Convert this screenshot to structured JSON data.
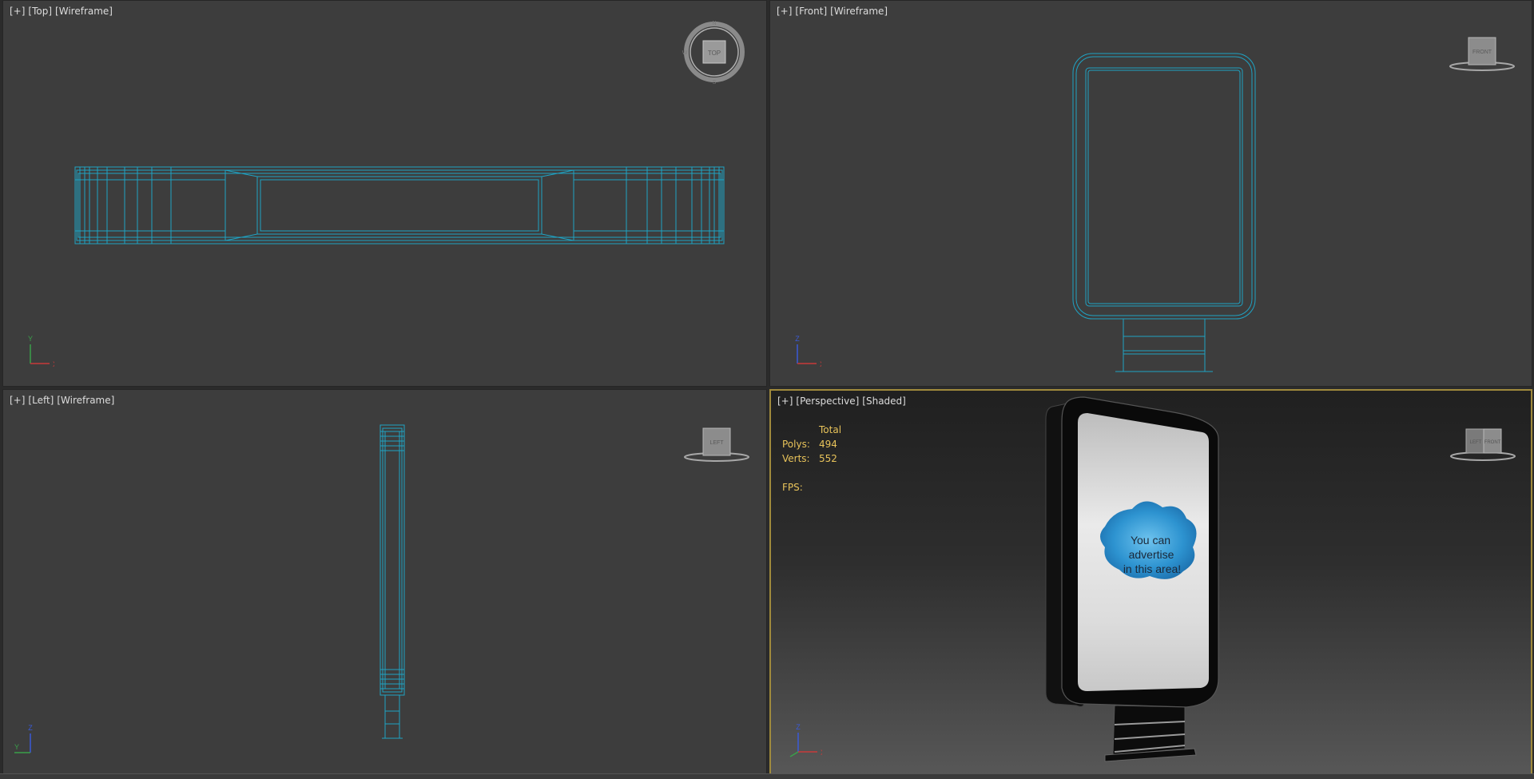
{
  "viewports": {
    "top": {
      "plus": "[+]",
      "view": "[Top]",
      "mode": "[Wireframe]",
      "cube_label": "TOP",
      "compass": {
        "n": "N",
        "s": "S",
        "w": "W"
      },
      "axis": {
        "a": "Y",
        "b": "X"
      }
    },
    "front": {
      "plus": "[+]",
      "view": "[Front]",
      "mode": "[Wireframe]",
      "cube_label": "FRONT",
      "axis": {
        "a": "Z",
        "b": "X"
      }
    },
    "left": {
      "plus": "[+]",
      "view": "[Left]",
      "mode": "[Wireframe]",
      "cube_label": "LEFT",
      "axis": {
        "a": "Z",
        "b": "Y"
      }
    },
    "persp": {
      "plus": "[+]",
      "view": "[Perspective]",
      "mode": "[Shaded]",
      "cube_label_a": "LEFT",
      "cube_label_b": "FRONT",
      "axis": {
        "a": "Z",
        "b": "X"
      }
    }
  },
  "stats": {
    "total_label": "Total",
    "polys_label": "Polys:",
    "polys_value": "494",
    "verts_label": "Verts:",
    "verts_value": "552",
    "fps_label": "FPS:"
  },
  "billboard_text": {
    "line1": "You can",
    "line2": "advertise",
    "line3": "in this area!"
  },
  "colors": {
    "viewport_bg": "#3d3d3d",
    "wire": "#1fa3c4",
    "active_border": "#a08a3c",
    "stats_text": "#e8c35a",
    "label_text": "#dcdcdc"
  }
}
